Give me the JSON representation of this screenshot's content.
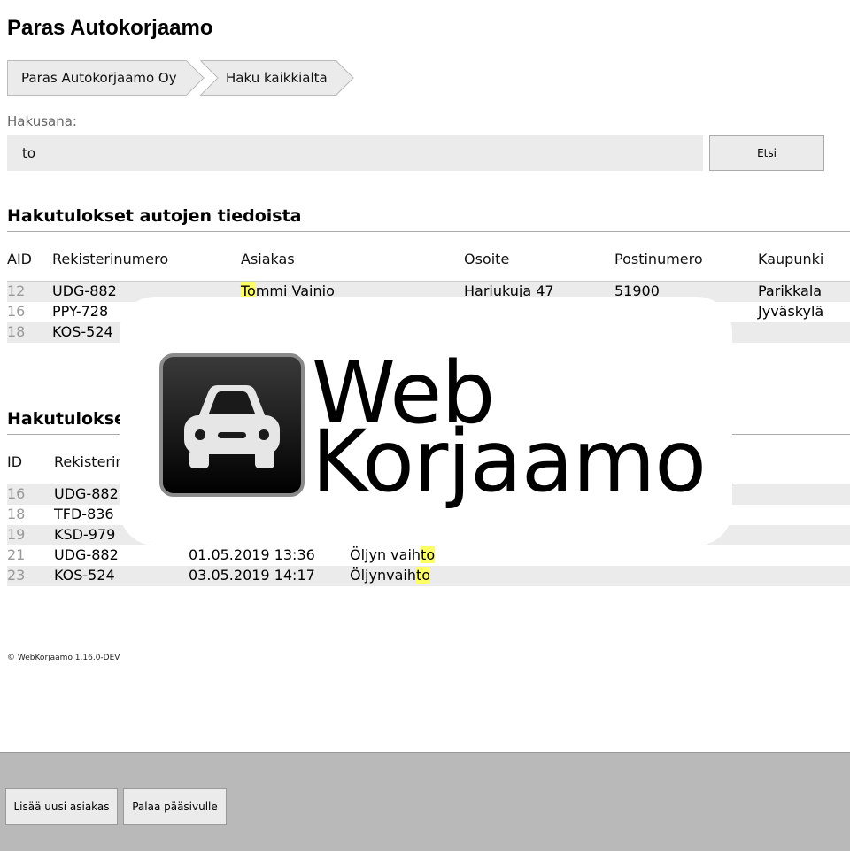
{
  "page_title": "Paras Autokorjaamo",
  "breadcrumb": [
    "Paras Autokorjaamo Oy",
    "Haku kaikkialta"
  ],
  "search": {
    "label": "Hakusana:",
    "value": "to",
    "button": "Etsi"
  },
  "cars_section": {
    "heading": "Hakutulokset autojen tiedoista",
    "columns": [
      "AID",
      "Rekisterinumero",
      "Asiakas",
      "Osoite",
      "Postinumero",
      "Kaupunki"
    ],
    "rows": [
      {
        "aid": "12",
        "reg": "UDG-882",
        "customer_hl": "To",
        "customer_rest": "mmi Vainio",
        "address": "Hariukuja 47",
        "zip": "51900",
        "city": "Parikkala"
      },
      {
        "aid": "16",
        "reg": "PPY-728",
        "city": "Jyväskylä"
      },
      {
        "aid": "18",
        "reg": "KOS-524"
      }
    ]
  },
  "jobs_section": {
    "heading_partial": "Hakutulokse",
    "columns": [
      "ID",
      "Rekisterin"
    ],
    "rows": [
      {
        "id": "16",
        "reg": "UDG-882"
      },
      {
        "id": "18",
        "reg": "TFD-836"
      },
      {
        "id": "19",
        "reg": "KSD-979"
      },
      {
        "id": "21",
        "reg": "UDG-882",
        "date": "01.05.2019 13:36",
        "desc_pre": "Öljyn vaih",
        "desc_hl": "to"
      },
      {
        "id": "23",
        "reg": "KOS-524",
        "date": "03.05.2019 14:17",
        "desc_pre": "Öljynvaih",
        "desc_hl": "to"
      }
    ]
  },
  "logo": {
    "line1": "Web",
    "line2": "Korjaamo",
    "icon": "car-icon"
  },
  "footer": {
    "copyright": "© WebKorjaamo 1.16.0-DEV"
  },
  "bottom_bar": {
    "add_customer": "Lisää uusi asiakas",
    "back_to_main": "Palaa pääsivulle"
  },
  "colors": {
    "highlight": "#ffff66",
    "row_alt": "#ebebeb",
    "bottom_bar": "#b9b9b9"
  }
}
